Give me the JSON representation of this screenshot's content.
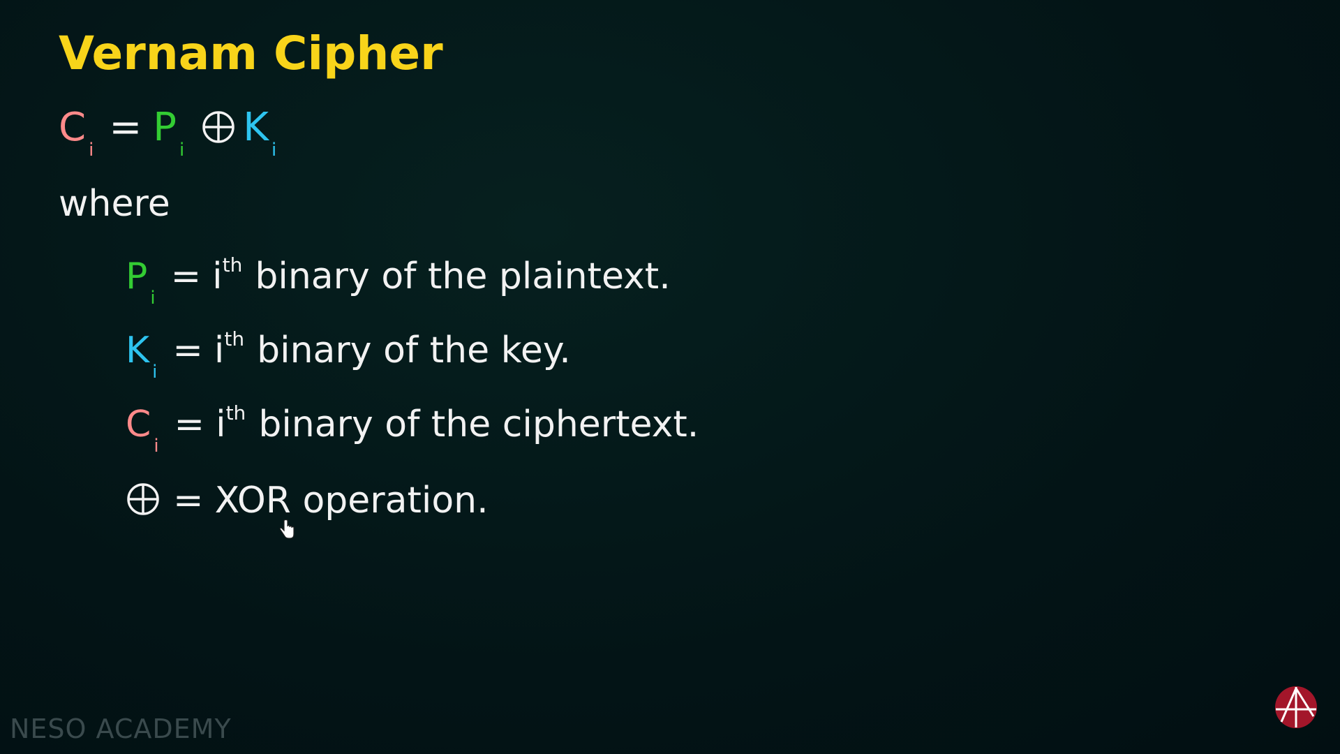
{
  "title": "Vernam Cipher",
  "formula": {
    "c": "C",
    "p": "P",
    "k": "K",
    "sub": "i",
    "eq": "="
  },
  "where_label": "where",
  "definitions": [
    {
      "symbol": "P",
      "sub": "i",
      "eq": "=",
      "base": "i",
      "sup": "th",
      "text": "binary of the plaintext."
    },
    {
      "symbol": "K",
      "sub": "i",
      "eq": "=",
      "base": "i",
      "sup": "th",
      "text": "binary of the key."
    },
    {
      "symbol": "C",
      "sub": "i",
      "eq": "=",
      "base": "i",
      "sup": "th",
      "text": "binary of the ciphertext."
    }
  ],
  "xor_def": {
    "eq": "=",
    "text": "XOR operation."
  },
  "watermark": "NESO ACADEMY",
  "colors": {
    "title": "#f8d41a",
    "ciphertext": "#ff8a8a",
    "plaintext": "#33cc33",
    "key": "#2ec4f0",
    "background": "#03161a",
    "logo": "#a3162a"
  },
  "icons": {
    "xor": "circled-plus-icon",
    "cursor": "hand-cursor-icon",
    "logo": "neso-logo-icon"
  }
}
